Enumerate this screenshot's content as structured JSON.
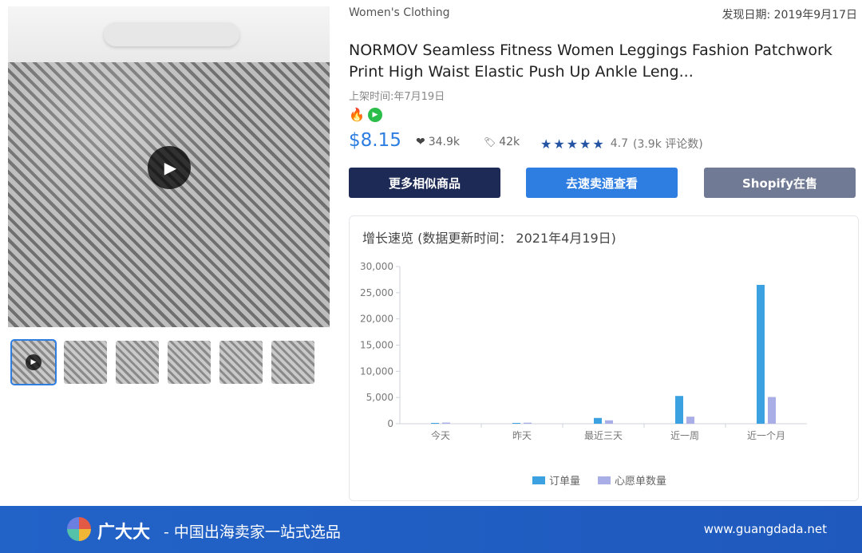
{
  "product": {
    "category": "Women's Clothing",
    "found_date": "发现日期: 2019年9月17日",
    "title": "NORMOV Seamless Fitness Women Leggings Fashion Patchwork Print High Waist Elastic Push Up Ankle Leng...",
    "listed_time": "上架时间:年7月19日",
    "price": "$8.15",
    "likes": "34.9k",
    "tags": "42k",
    "rating": "4.7",
    "reviews": "(3.9k 评论数)",
    "stars": "★★★★★"
  },
  "buttons": {
    "similar": "更多相似商品",
    "smt": "去速卖通查看",
    "shopify": "Shopify在售"
  },
  "icons": {
    "play": "▶",
    "fire": "🔥",
    "heart": "❤",
    "tag": "🏷"
  },
  "chart_title": "增长速览 (数据更新时间：  2021年4月19日)",
  "chart_data": {
    "type": "bar",
    "categories": [
      "今天",
      "昨天",
      "最近三天",
      "近一周",
      "近一个月"
    ],
    "ylim": [
      0,
      30000
    ],
    "yticks": [
      "0",
      "5,000",
      "10,000",
      "15,000",
      "20,000",
      "25,000",
      "30,000"
    ],
    "series": [
      {
        "name": "订单量",
        "color": "#3ba1e0",
        "values": [
          150,
          100,
          1100,
          5300,
          26500
        ]
      },
      {
        "name": "心愿单数量",
        "color": "#a9afe6",
        "values": [
          220,
          200,
          650,
          1350,
          5100
        ]
      }
    ],
    "legend_position": "bottom",
    "grid": false
  },
  "footer": {
    "brand": "广大大",
    "slogan": "- 中国出海卖家一站式选品",
    "site": "www.guangdada.net"
  }
}
